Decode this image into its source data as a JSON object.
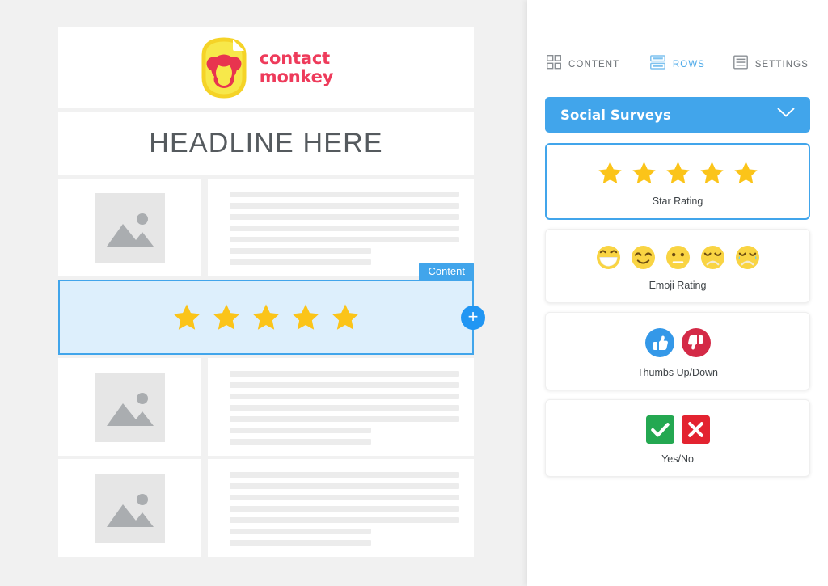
{
  "email_preview": {
    "logo": {
      "icon_name": "contactmonkey-logo",
      "line1": "contact",
      "line2": "monkey",
      "brand_color": "#ee3b5b",
      "badge_color": "#f5d327"
    },
    "headline": "HEADLINE HERE",
    "content_rows": [
      {
        "image_placeholder": "image-placeholder-icon",
        "line_widths": [
          "w100",
          "w100",
          "w100",
          "w100",
          "w100",
          "w62",
          "w62"
        ]
      },
      {
        "image_placeholder": "image-placeholder-icon",
        "line_widths": [
          "w100",
          "w100",
          "w100",
          "w100",
          "w100",
          "w62",
          "w62"
        ]
      },
      {
        "image_placeholder": "image-placeholder-icon",
        "line_widths": [
          "w100",
          "w100",
          "w100",
          "w100",
          "w100",
          "w62",
          "w62"
        ]
      }
    ],
    "selected_block": {
      "type": "star-rating",
      "badge_label": "Content",
      "add_button_label": "+",
      "stars": 5,
      "star_color": "#fbc419",
      "selection_border_color": "#41a5eb",
      "selection_fill_color": "#ddeffc"
    }
  },
  "sidebar": {
    "tabs": [
      {
        "label": "CONTENT",
        "icon": "grid-icon",
        "active": false
      },
      {
        "label": "ROWS",
        "icon": "rows-icon",
        "active": true
      },
      {
        "label": "SETTINGS",
        "icon": "settings-list-icon",
        "active": false
      }
    ],
    "panel": {
      "title": "Social Surveys",
      "chevron_icon": "chevron-down-icon",
      "accent_color": "#41a5eb"
    },
    "options": [
      {
        "id": "star-rating",
        "label": "Star Rating",
        "selected": true,
        "icon_set": "stars"
      },
      {
        "id": "emoji-rating",
        "label": "Emoji Rating",
        "selected": false,
        "icon_set": "emoji"
      },
      {
        "id": "thumbs",
        "label": "Thumbs Up/Down",
        "selected": false,
        "icon_set": "thumbs"
      },
      {
        "id": "yes-no",
        "label": "Yes/No",
        "selected": false,
        "icon_set": "yesno"
      }
    ]
  }
}
